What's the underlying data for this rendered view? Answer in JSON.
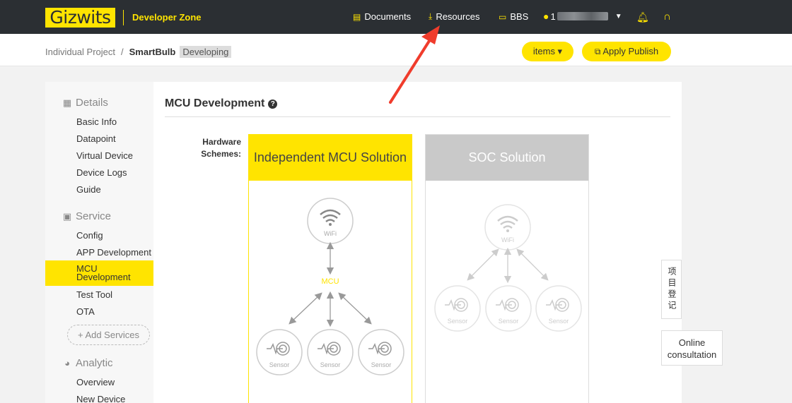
{
  "topbar": {
    "logo": "Gizwits",
    "zone": "Developer Zone",
    "nav": [
      {
        "label": "Documents",
        "icon": "document-icon"
      },
      {
        "label": "Resources",
        "icon": "download-icon"
      },
      {
        "label": "BBS",
        "icon": "chat-icon"
      }
    ],
    "user_prefix": "1",
    "icons": [
      "user-icon",
      "bell-icon",
      "headset-icon"
    ]
  },
  "breadcrumb": {
    "parent": "Individual Project",
    "separator": "/",
    "project": "SmartBulb",
    "status": "Developing"
  },
  "actions": {
    "items_label": "items ▾",
    "publish_label": "Apply Publish"
  },
  "sidebar": {
    "details": {
      "title": "Details",
      "items": [
        "Basic Info",
        "Datapoint",
        "Virtual Device",
        "Device Logs",
        "Guide"
      ]
    },
    "service": {
      "title": "Service",
      "items": [
        "Config",
        "APP Development",
        "MCU Development",
        "Test Tool",
        "OTA"
      ],
      "active": "MCU Development"
    },
    "add_services": "+ Add Services",
    "analytic": {
      "title": "Analytic",
      "items": [
        "Overview",
        "New Device"
      ]
    }
  },
  "main": {
    "title": "MCU Development",
    "hardware_label": "Hardware Schemes:",
    "solutions": [
      {
        "title": "Independent MCU Solution",
        "wifi": "WiFi",
        "mcu": "MCU",
        "sensor": "Sensor"
      },
      {
        "title": "SOC Solution",
        "wifi": "WiFi",
        "sensor": "Sensor"
      }
    ]
  },
  "float": {
    "register": "项目登记",
    "online": "Online consultation"
  },
  "colors": {
    "accent": "#ffe400",
    "topbar": "#2b2f33",
    "annotation": "#f03c2c"
  }
}
